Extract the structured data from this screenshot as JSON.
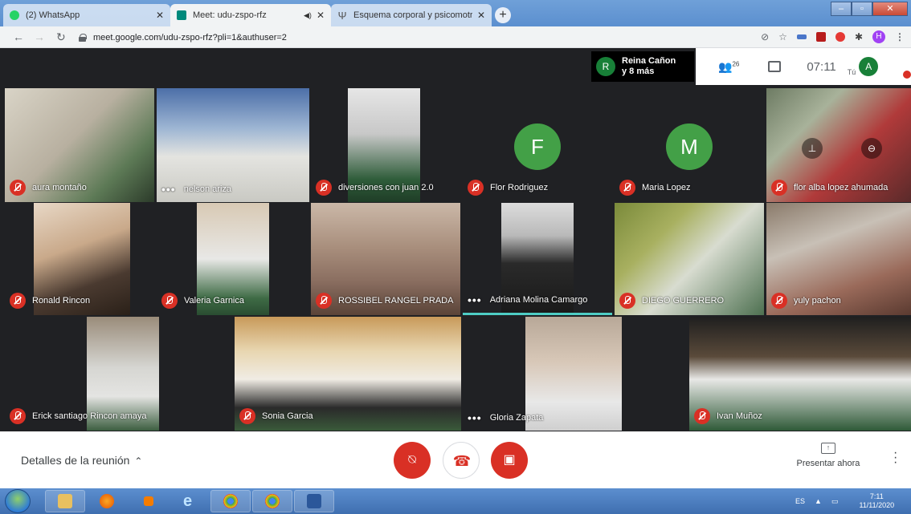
{
  "browser": {
    "tabs": [
      {
        "title": "(2) WhatsApp",
        "favicon_color": "#25d366",
        "active": false
      },
      {
        "title": "Meet: udu-zspo-rfz",
        "favicon_color": "#00897b",
        "active": true
      },
      {
        "title": "Esquema corporal y psicomotric",
        "favicon_color": "#555555",
        "active": false
      }
    ],
    "url": "meet.google.com/udu-zspo-rfz?pli=1&authuser=2",
    "profile_initial": "H"
  },
  "meet": {
    "presenter": {
      "initial": "R",
      "line1": "Reina Cañon",
      "line2": "y 8 más"
    },
    "people_count": "26",
    "clock": "07:11",
    "self_label": "Tú",
    "self_initial": "A",
    "tiles": [
      {
        "name": "aura montaño",
        "status": "muted",
        "type": "video"
      },
      {
        "name": "nelson ariza",
        "status": "speaking",
        "type": "video"
      },
      {
        "name": "diversiones con juan 2.0",
        "status": "muted",
        "type": "video"
      },
      {
        "name": "Flor Rodriguez",
        "status": "muted",
        "type": "avatar",
        "initial": "F"
      },
      {
        "name": "Maria Lopez",
        "status": "muted",
        "type": "avatar",
        "initial": "M"
      },
      {
        "name": "flor alba lopez ahumada",
        "status": "muted",
        "type": "video"
      },
      {
        "name": "Ronald Rincon",
        "status": "muted",
        "type": "video"
      },
      {
        "name": "Valeria Garnica",
        "status": "muted",
        "type": "video"
      },
      {
        "name": "ROSSIBEL RANGEL PRADA",
        "status": "muted",
        "type": "video"
      },
      {
        "name": "Adriana Molina Camargo",
        "status": "speaking",
        "type": "video"
      },
      {
        "name": "DIEGO GUERRERO",
        "status": "muted",
        "type": "video"
      },
      {
        "name": "yuly pachon",
        "status": "muted",
        "type": "video"
      },
      {
        "name": "Erick santiago Rincon amaya",
        "status": "muted",
        "type": "video"
      },
      {
        "name": "Sonia Garcia",
        "status": "muted",
        "type": "video"
      },
      {
        "name": "Gloria Zapata",
        "status": "speaking",
        "type": "video"
      },
      {
        "name": "Ivan Muñoz",
        "status": "muted",
        "type": "video"
      }
    ],
    "bottom": {
      "details_label": "Detalles de la reunión",
      "present_label": "Presentar ahora"
    }
  },
  "taskbar": {
    "language": "ES",
    "time": "7:11",
    "date": "11/11/2020"
  }
}
